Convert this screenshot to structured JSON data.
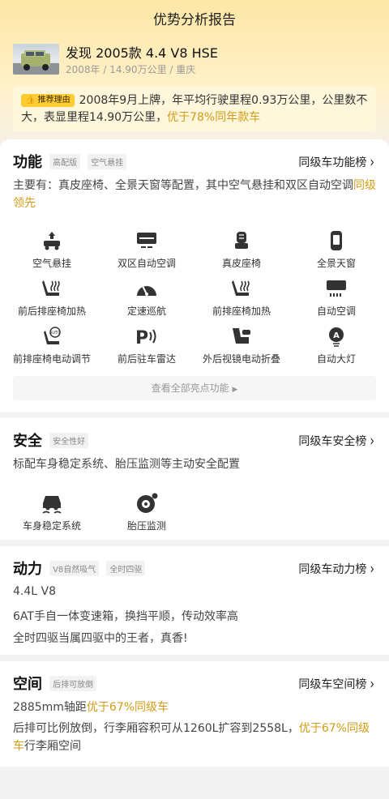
{
  "page_title": "优势分析报告",
  "car": {
    "name": "发现 2005款 4.4 V8 HSE",
    "meta": "2008年 / 14.90万公里 / 重庆"
  },
  "reason": {
    "badge": "推荐理由",
    "text": "2008年9月上牌，年平均行驶里程0.93万公里，公里数不大，表显里程14.90万公里，",
    "highlight": "优于78%同年款车"
  },
  "function": {
    "title": "功能",
    "chips": [
      "高配版",
      "空气悬挂"
    ],
    "rank": "同级车功能榜",
    "desc_text": "主要有：真皮座椅、全景天窗等配置，其中空气悬挂和双区自动空调",
    "desc_highlight": "同级领先",
    "items": [
      {
        "label": "空气悬挂",
        "icon": "air-suspension-icon"
      },
      {
        "label": "双区自动空调",
        "icon": "dual-zone-ac-icon"
      },
      {
        "label": "真皮座椅",
        "icon": "leather-seat-icon"
      },
      {
        "label": "全景天窗",
        "icon": "panoramic-sunroof-icon"
      },
      {
        "label": "前后排座椅加热",
        "icon": "seat-heating-icon"
      },
      {
        "label": "定速巡航",
        "icon": "cruise-control-icon"
      },
      {
        "label": "前排座椅加热",
        "icon": "front-seat-heating-icon"
      },
      {
        "label": "自动空调",
        "icon": "auto-ac-icon"
      },
      {
        "label": "前排座椅电动调节",
        "icon": "power-seat-icon"
      },
      {
        "label": "前后驻车雷达",
        "icon": "parking-radar-icon"
      },
      {
        "label": "外后视镜电动折叠",
        "icon": "mirror-fold-icon"
      },
      {
        "label": "自动大灯",
        "icon": "auto-headlight-icon"
      }
    ],
    "more_label": "查看全部亮点功能"
  },
  "safety": {
    "title": "安全",
    "chips": [
      "安全性好"
    ],
    "rank": "同级车安全榜",
    "desc": "标配车身稳定系统、胎压监测等主动安全配置",
    "items": [
      {
        "label": "车身稳定系统",
        "icon": "stability-control-icon"
      },
      {
        "label": "胎压监测",
        "icon": "tire-pressure-icon"
      }
    ]
  },
  "power": {
    "title": "动力",
    "chips": [
      "V8自然吸气",
      "全时四驱"
    ],
    "rank": "同级车动力榜",
    "lines": [
      "4.4L V8",
      "6AT手自一体变速箱，换挡平顺，传动效率高",
      "全时四驱当属四驱中的王者，真香!"
    ]
  },
  "space": {
    "title": "空间",
    "chips": [
      "后排可放倒"
    ],
    "rank": "同级车空间榜",
    "line1_text": "2885mm轴距",
    "line1_highlight": "优于67%同级车",
    "line2_text": "后排可比例放倒，行李厢容积可从1260L扩容到2558L，",
    "line2_highlight": "优于67%同级车",
    "line2_tail": "行李厢空间"
  },
  "colors": {
    "accent": "#d29b15",
    "badge": "#ffcc33",
    "header_bg": "#fde7a6"
  }
}
